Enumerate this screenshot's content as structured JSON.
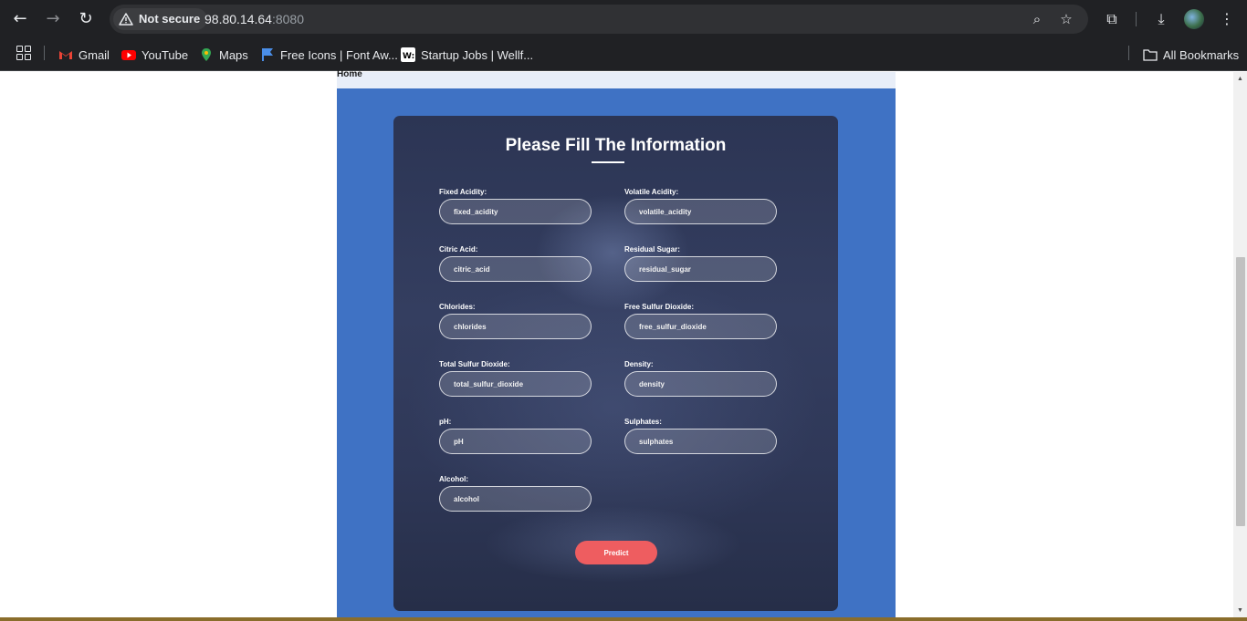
{
  "browser": {
    "security_label": "Not secure",
    "url_host": "98.80.14.64",
    "url_port": ":8080",
    "bookmarks": [
      {
        "label": "Gmail"
      },
      {
        "label": "YouTube"
      },
      {
        "label": "Maps"
      },
      {
        "label": "Free Icons | Font Aw..."
      },
      {
        "label": "Startup Jobs | Wellf..."
      }
    ],
    "all_bookmarks_label": "All Bookmarks"
  },
  "page": {
    "home_link": "Home",
    "form_title": "Please Fill The Information",
    "fields": [
      {
        "label": "Fixed Acidity:",
        "placeholder": "fixed_acidity"
      },
      {
        "label": "Volatile Acidity:",
        "placeholder": "volatile_acidity"
      },
      {
        "label": "Citric Acid:",
        "placeholder": "citric_acid"
      },
      {
        "label": "Residual Sugar:",
        "placeholder": "residual_sugar"
      },
      {
        "label": "Chlorides:",
        "placeholder": "chlorides"
      },
      {
        "label": "Free Sulfur Dioxide:",
        "placeholder": "free_sulfur_dioxide"
      },
      {
        "label": "Total Sulfur Dioxide:",
        "placeholder": "total_sulfur_dioxide"
      },
      {
        "label": "Density:",
        "placeholder": "density"
      },
      {
        "label": "pH:",
        "placeholder": "pH"
      },
      {
        "label": "Sulphates:",
        "placeholder": "sulphates"
      },
      {
        "label": "Alcohol:",
        "placeholder": "alcohol"
      }
    ],
    "submit_label": "Predict"
  },
  "colors": {
    "page_background": "#3f72c4",
    "card_background": "#2f3858",
    "predict_button": "#ee5d60"
  }
}
